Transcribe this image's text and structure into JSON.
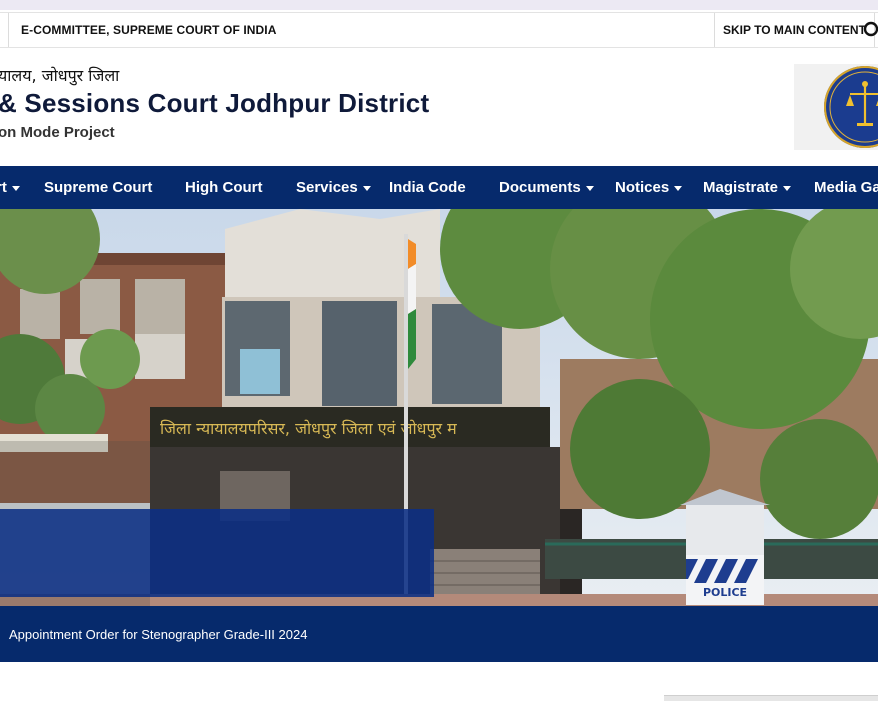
{
  "utility_bar": {
    "committee_link": "E-COMMITTEE, SUPREME COURT OF INDIA",
    "skip_link": "SKIP TO MAIN CONTENT"
  },
  "header": {
    "hindi_name": "यालय, जोधपुर जिला",
    "title": "& Sessions Court Jodhpur District",
    "subtitle": "on Mode Project",
    "logo_icon": "ecourts-emblem-icon"
  },
  "nav": {
    "items": [
      {
        "label": "rt",
        "has_dropdown": true
      },
      {
        "label": "Supreme Court",
        "has_dropdown": false
      },
      {
        "label": "High Court",
        "has_dropdown": false
      },
      {
        "label": "Services",
        "has_dropdown": true
      },
      {
        "label": "India Code",
        "has_dropdown": false
      },
      {
        "label": "Documents",
        "has_dropdown": true
      },
      {
        "label": "Notices",
        "has_dropdown": true
      },
      {
        "label": "Magistrate",
        "has_dropdown": true
      },
      {
        "label": "Media Ga",
        "has_dropdown": false
      }
    ]
  },
  "hero": {
    "building_sign": "जिला न्यायालयपरिसर, जोधपुर जिला एवं जोधपुर म",
    "booth_sign": "POLICE"
  },
  "ticker": {
    "text": "Appointment Order for Stenographer Grade-III 2024"
  },
  "colors": {
    "nav_bg": "#062a6c",
    "title": "#0f1a3a",
    "overlay": "#0b2f84"
  }
}
